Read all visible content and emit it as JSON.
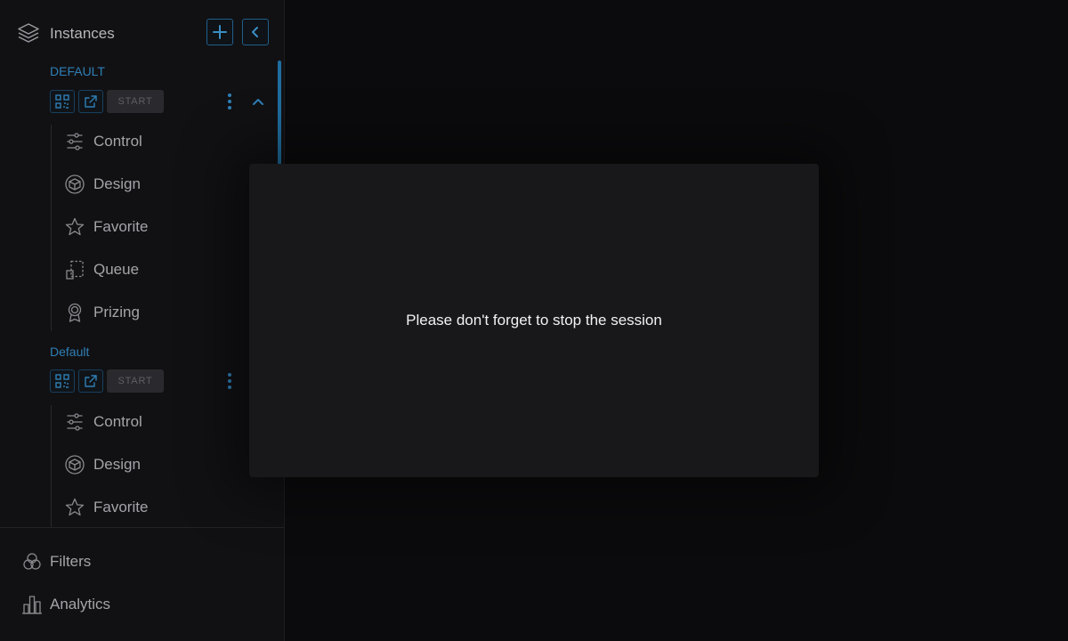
{
  "sidebar": {
    "header": {
      "title": "Instances",
      "add_icon": "plus-icon",
      "collapse_icon": "chevron-left-icon"
    },
    "groups": [
      {
        "label": "DEFAULT",
        "start_label": "START",
        "expanded": true,
        "items": [
          {
            "label": "Control",
            "icon": "sliders-icon"
          },
          {
            "label": "Design",
            "icon": "cube-icon"
          },
          {
            "label": "Favorite",
            "icon": "star-icon"
          },
          {
            "label": "Queue",
            "icon": "queue-icon"
          },
          {
            "label": "Prizing",
            "icon": "award-icon"
          }
        ]
      },
      {
        "label": "Default",
        "start_label": "START",
        "expanded": true,
        "items": [
          {
            "label": "Control",
            "icon": "sliders-icon"
          },
          {
            "label": "Design",
            "icon": "cube-icon"
          },
          {
            "label": "Favorite",
            "icon": "star-icon"
          }
        ]
      }
    ],
    "footer": [
      {
        "label": "Filters",
        "icon": "filters-icon"
      },
      {
        "label": "Analytics",
        "icon": "bar-chart-icon"
      }
    ]
  },
  "modal": {
    "message": "Please don't forget to stop the session"
  },
  "colors": {
    "accent": "#2f7fb5",
    "background": "#0b0b0d",
    "sidebar": "#111114",
    "modal": "#18181a"
  }
}
